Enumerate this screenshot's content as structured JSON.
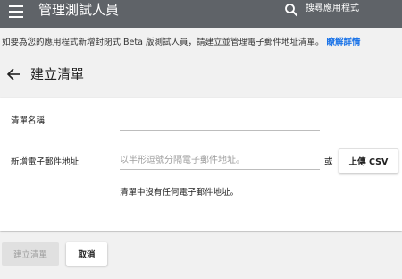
{
  "header": {
    "menu_icon": "hamburger-menu-icon",
    "title": "管理測試人員",
    "search_icon": "search-icon",
    "search_label": "搜尋應用程式"
  },
  "notice": {
    "text": "如要為您的應用程式新增封閉式 Beta 版測試人員，請建立並管理電子郵件地址清單。",
    "link": "瞭解詳情"
  },
  "page": {
    "back_icon": "back-arrow-icon",
    "title": "建立清單"
  },
  "form": {
    "list_name_label": "清單名稱",
    "list_name_value": "",
    "emails_label": "新增電子郵件地址",
    "emails_placeholder": "以半形逗號分隔電子郵件地址。",
    "emails_value": "",
    "or_label": "或",
    "upload_label": "上傳 CSV",
    "empty_message": "清單中沒有任何電子郵件地址。"
  },
  "actions": {
    "create_label": "建立清單",
    "cancel_label": "取消"
  },
  "colors": {
    "header_bg": "#5f6368",
    "link": "#1a73e8",
    "page_bg": "#f1f1f1"
  }
}
